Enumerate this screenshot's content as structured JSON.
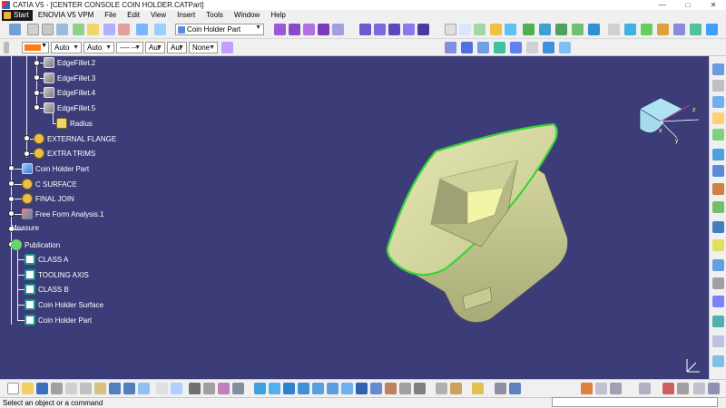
{
  "window": {
    "title": "CATIA V5 - [CENTER CONSOLE COIN HOLDER.CATPart]",
    "minimize": "—",
    "maximize": "□",
    "close": "✕"
  },
  "menu": {
    "items": [
      "Start",
      "ENOVIA V5 VPM",
      "File",
      "Edit",
      "View",
      "Insert",
      "Tools",
      "Window",
      "Help"
    ]
  },
  "toolbar": {
    "part_selector": "Coin Holder Part",
    "color": "#ff7d10",
    "combos": [
      "Auto",
      "Auto",
      "---- ---",
      "Aut",
      "Aut",
      "None"
    ]
  },
  "tree": {
    "items": [
      {
        "label": "EdgeFillet.2",
        "icon": "edge-fillet-icon"
      },
      {
        "label": "EdgeFillet.3",
        "icon": "edge-fillet-icon"
      },
      {
        "label": "EdgeFillet.4",
        "icon": "edge-fillet-icon"
      },
      {
        "label": "EdgeFillet.5",
        "icon": "edge-fillet-icon"
      },
      {
        "label": "Radius",
        "icon": "parameter-icon"
      },
      {
        "label": "EXTERNAL FLANGE",
        "icon": "geometrical-set-icon"
      },
      {
        "label": "EXTRA TRIMS",
        "icon": "geometrical-set-icon"
      },
      {
        "label": "Coin Holder Part",
        "icon": "part-body-icon"
      },
      {
        "label": "C SURFACE",
        "icon": "geometrical-set-icon"
      },
      {
        "label": "FINAL JOIN",
        "icon": "geometrical-set-icon"
      },
      {
        "label": "Free Form Analysis.1",
        "icon": "free-form-analysis-icon"
      },
      {
        "label": "Measure",
        "icon": "measure-icon"
      },
      {
        "label": "Publication",
        "icon": "publication-icon"
      },
      {
        "label": "CLASS A",
        "icon": "publication-item-icon"
      },
      {
        "label": "TOOLING AXIS",
        "icon": "publication-item-icon"
      },
      {
        "label": "CLASS B",
        "icon": "publication-item-icon"
      },
      {
        "label": "Coin Holder Surface",
        "icon": "publication-item-icon"
      },
      {
        "label": "Coin Holder Part",
        "icon": "publication-item-icon"
      }
    ]
  },
  "compass": {
    "x": "x",
    "y": "y",
    "z": "z"
  },
  "viewport": {
    "background": "#3c3c78",
    "part_color": "#d9dba0",
    "edge_highlight": "#39d339"
  },
  "status": {
    "message": "Select an object or a command"
  }
}
